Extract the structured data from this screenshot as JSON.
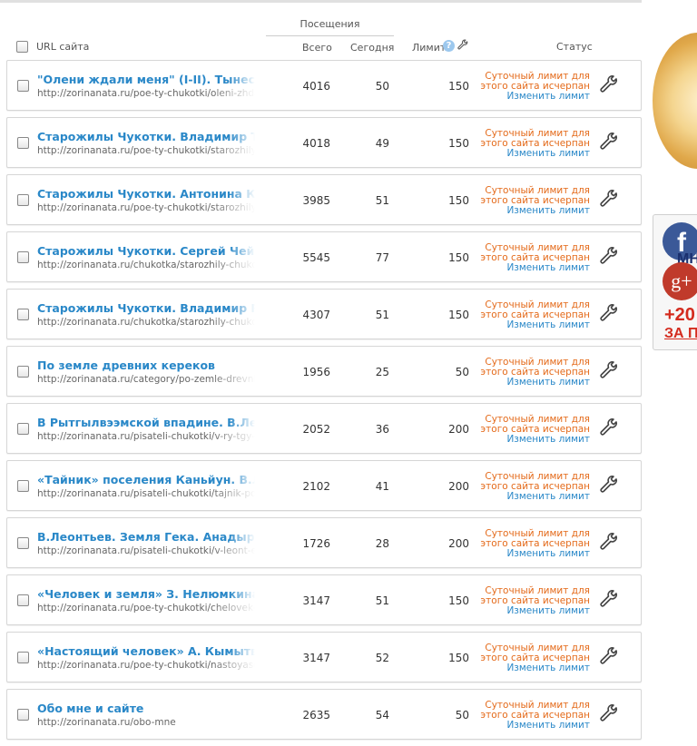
{
  "header": {
    "visits_label": "Посещения",
    "url_label": "URL сайта",
    "total_label": "Всего",
    "today_label": "Сегодня",
    "limit_label": "Лимит",
    "status_label": "Статус",
    "help_icon_glyph": "?"
  },
  "rows": [
    {
      "title": "\"Олени ждали меня\" (I-II). Тынескин",
      "url": "http://zorinanata.ru/poe-ty-chukotki/oleni-zhdali",
      "total": "4016",
      "today": "50",
      "limit": "150",
      "status_line1": "Суточный лимит для",
      "status_line2": "этого сайта исчерпан",
      "status_link": "Изменить лимит"
    },
    {
      "title": "Старожилы Чукотки. Владимир Тыне",
      "url": "http://zorinanata.ru/poe-ty-chukotki/starozhily-ch",
      "total": "4018",
      "today": "49",
      "limit": "150",
      "status_line1": "Суточный лимит для",
      "status_line2": "этого сайта исчерпан",
      "status_link": "Изменить лимит"
    },
    {
      "title": "Старожилы Чукотки. Антонина Кымы",
      "url": "http://zorinanata.ru/poe-ty-chukotki/starozhily-ch",
      "total": "3985",
      "today": "51",
      "limit": "150",
      "status_line1": "Суточный лимит для",
      "status_line2": "этого сайта исчерпан",
      "status_link": "Изменить лимит"
    },
    {
      "title": "Старожилы Чукотки. Сергей Чейвуте",
      "url": "http://zorinanata.ru/chukotka/starozhily-chukotki",
      "total": "5545",
      "today": "77",
      "limit": "150",
      "status_line1": "Суточный лимит для",
      "status_line2": "этого сайта исчерпан",
      "status_link": "Изменить лимит"
    },
    {
      "title": "Старожилы Чукотки. Владимир Ровт",
      "url": "http://zorinanata.ru/chukotka/starozhily-chukotki",
      "total": "4307",
      "today": "51",
      "limit": "150",
      "status_line1": "Суточный лимит для",
      "status_line2": "этого сайта исчерпан",
      "status_link": "Изменить лимит"
    },
    {
      "title": "По земле древних кереков",
      "url": "http://zorinanata.ru/category/po-zemle-drevnih-k",
      "total": "1956",
      "today": "25",
      "limit": "50",
      "status_line1": "Суточный лимит для",
      "status_line2": "этого сайта исчерпан",
      "status_link": "Изменить лимит"
    },
    {
      "title": "В Рытгылвээмской впадине. В.Леонть",
      "url": "http://zorinanata.ru/pisateli-chukotki/v-ry-tgy-lve",
      "total": "2052",
      "today": "36",
      "limit": "200",
      "status_line1": "Суточный лимит для",
      "status_line2": "этого сайта исчерпан",
      "status_link": "Изменить лимит"
    },
    {
      "title": "«Тайник» поселения Каньйун. В.Леон",
      "url": "http://zorinanata.ru/pisateli-chukotki/tajnik-posel",
      "total": "2102",
      "today": "41",
      "limit": "200",
      "status_line1": "Суточный лимит для",
      "status_line2": "этого сайта исчерпан",
      "status_link": "Изменить лимит"
    },
    {
      "title": "В.Леонтьев. Земля Гека. Анадырский",
      "url": "http://zorinanata.ru/pisateli-chukotki/v-leont-ev-",
      "total": "1726",
      "today": "28",
      "limit": "200",
      "status_line1": "Суточный лимит для",
      "status_line2": "этого сайта исчерпан",
      "status_link": "Изменить лимит"
    },
    {
      "title": "«Человек и земля» З. Нелюмкина",
      "url": "http://zorinanata.ru/poe-ty-chukotki/chelovek-y-",
      "total": "3147",
      "today": "51",
      "limit": "150",
      "status_line1": "Суточный лимит для",
      "status_line2": "этого сайта исчерпан",
      "status_link": "Изменить лимит"
    },
    {
      "title": "«Настоящий человек» А. Кымытваль",
      "url": "http://zorinanata.ru/poe-ty-chukotki/nastoyasch",
      "total": "3147",
      "today": "52",
      "limit": "150",
      "status_line1": "Суточный лимит для",
      "status_line2": "этого сайта исчерпан",
      "status_link": "Изменить лимит"
    },
    {
      "title": "Обо мне и сайте",
      "url": "http://zorinanata.ru/obo-mne",
      "total": "2635",
      "today": "54",
      "limit": "50",
      "status_line1": "Суточный лимит для",
      "status_line2": "этого сайта исчерпан",
      "status_link": "Изменить лимит"
    }
  ],
  "sidebar": {
    "fb_glyph": "f",
    "gplus_glyph": "g+",
    "mn_text": "МН",
    "plus_text": "+20",
    "za_text": "ЗА П"
  },
  "colors": {
    "link": "#2a88c8",
    "warning": "#e46a1a",
    "facebook": "#3b5998",
    "gplus": "#c03a2b"
  }
}
